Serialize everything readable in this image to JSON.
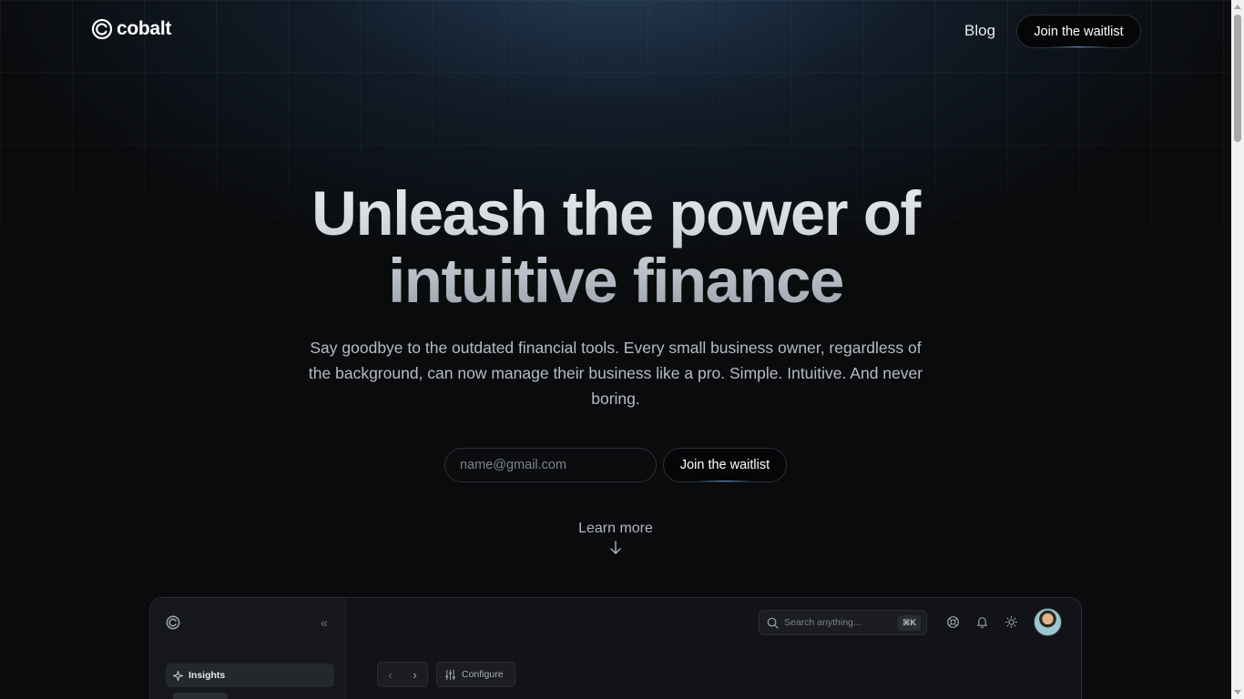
{
  "brand": {
    "name": "cobalt",
    "icon": "cobalt-logo-icon"
  },
  "nav": {
    "blog_label": "Blog",
    "cta_label": "Join the waitlist"
  },
  "hero": {
    "title_line1": "Unleash the power of",
    "title_line2": "intuitive finance",
    "subtitle": "Say goodbye to the outdated financial tools. Every small business owner, regardless of the background, can now manage their business like a pro. Simple. Intuitive. And never boring.",
    "email_placeholder": "name@gmail.com",
    "cta_label": "Join the waitlist",
    "learn_more_label": "Learn more"
  },
  "preview": {
    "sidebar": {
      "active_item": "Insights"
    },
    "search": {
      "placeholder": "Search anything...",
      "shortcut": "⌘K"
    },
    "toolbar": {
      "configure_label": "Configure",
      "back_glyph": "‹",
      "forward_glyph": "›"
    },
    "icons": [
      "support-icon",
      "bell-icon",
      "sun-icon"
    ]
  },
  "colors": {
    "background": "#0a0b0d",
    "accent_glow": "#2e4e70",
    "button_bg": "#050607",
    "button_underline": "#5a8dc4"
  }
}
